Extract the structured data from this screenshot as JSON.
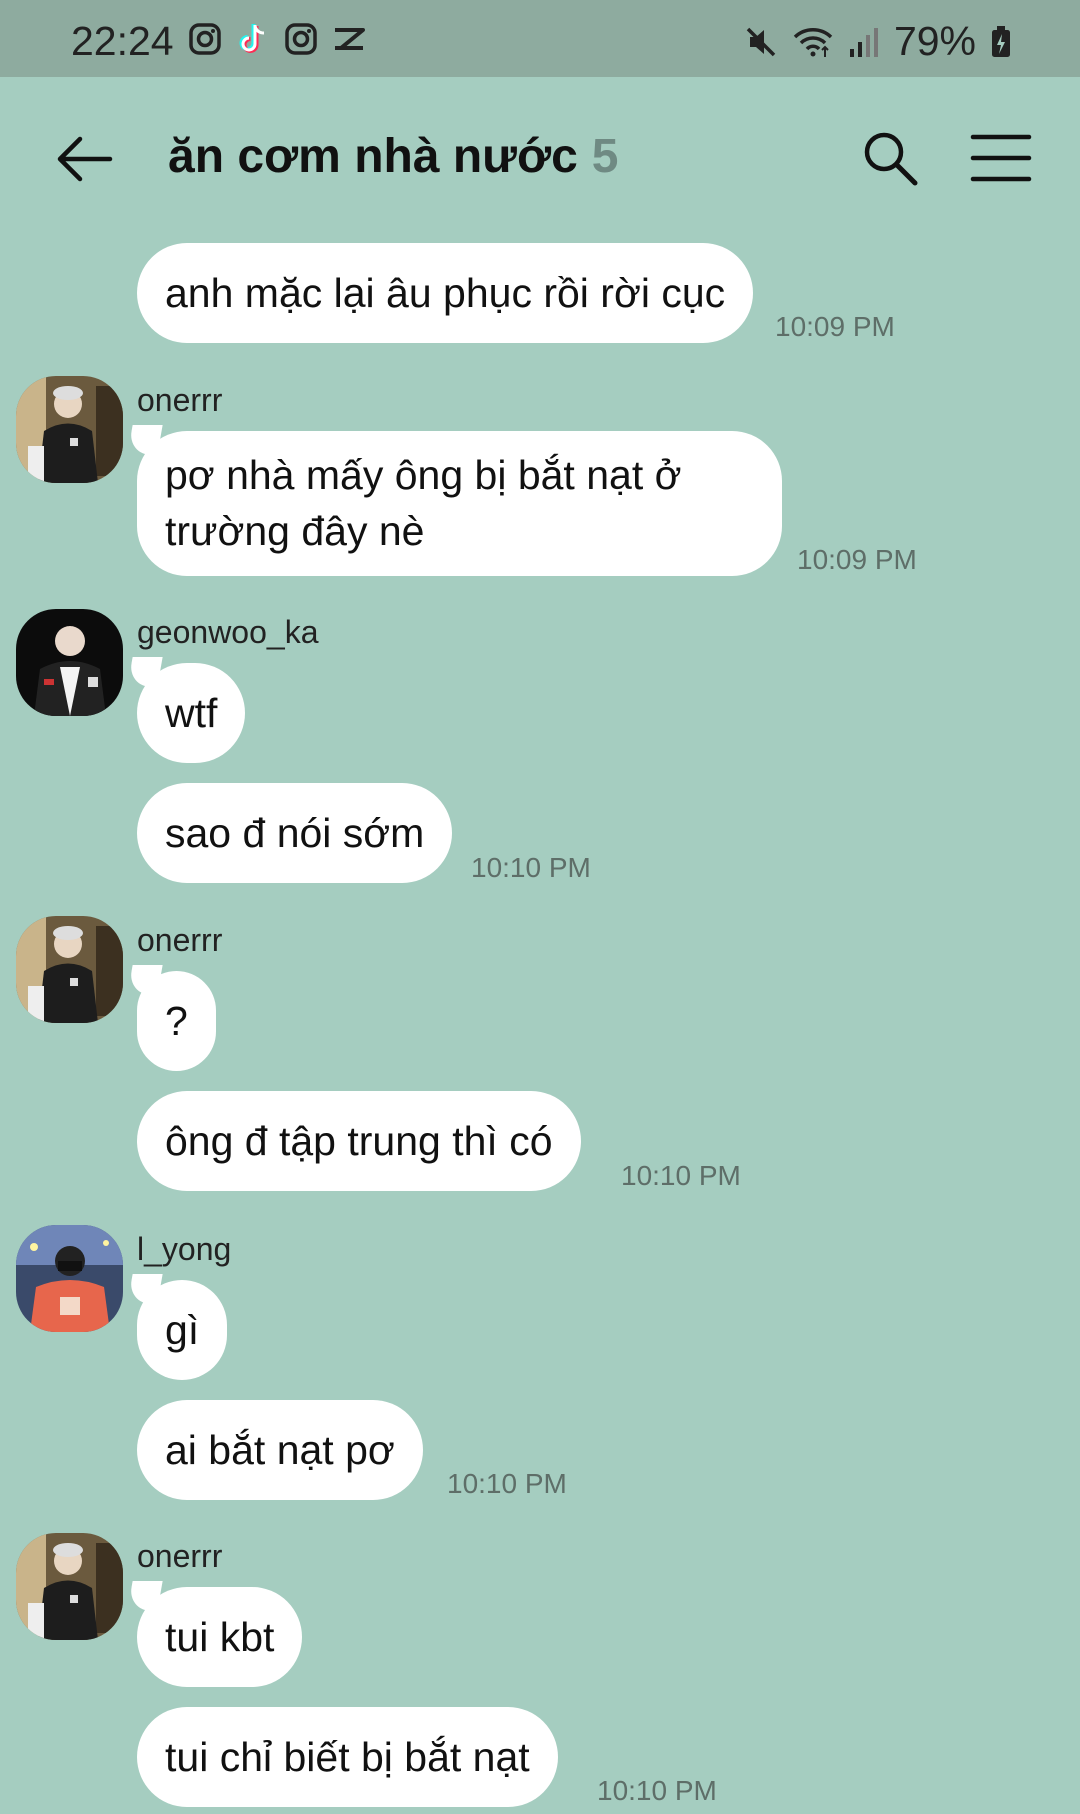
{
  "status_bar": {
    "time": "22:24",
    "battery": "79%",
    "left_icons": [
      "instagram-icon",
      "tiktok-icon",
      "instagram-icon",
      "capcut-icon"
    ],
    "right_icons": [
      "mute-icon",
      "wifi-icon",
      "signal-icon",
      "battery-charging-icon"
    ]
  },
  "header": {
    "title": "ăn cơm nhà nước",
    "member_count": "5"
  },
  "messages": [
    {
      "text": "anh mặc lại âu phục rồi rời cục",
      "time": "10:09 PM"
    },
    {
      "sender": "onerrr",
      "text": "pơ nhà mấy ông bị bắt nạt ở trường đây nè",
      "time": "10:09 PM"
    },
    {
      "sender": "geonwoo_ka",
      "text": "wtf"
    },
    {
      "text": "sao đ nói sớm",
      "time": "10:10 PM"
    },
    {
      "sender": "onerrr",
      "text": "?"
    },
    {
      "text": "ông đ tập trung thì có",
      "time": "10:10 PM"
    },
    {
      "sender": "l_yong",
      "text": "gì"
    },
    {
      "text": "ai bắt nạt pơ",
      "time": "10:10 PM"
    },
    {
      "sender": "onerrr",
      "text": "tui kbt"
    },
    {
      "text": "tui chỉ biết bị bắt nạt",
      "time": "10:10 PM"
    }
  ],
  "colors": {
    "background": "#a5cdc0",
    "status_bar": "#8eab9f",
    "bubble": "#ffffff",
    "member_count": "#6f8a83"
  }
}
